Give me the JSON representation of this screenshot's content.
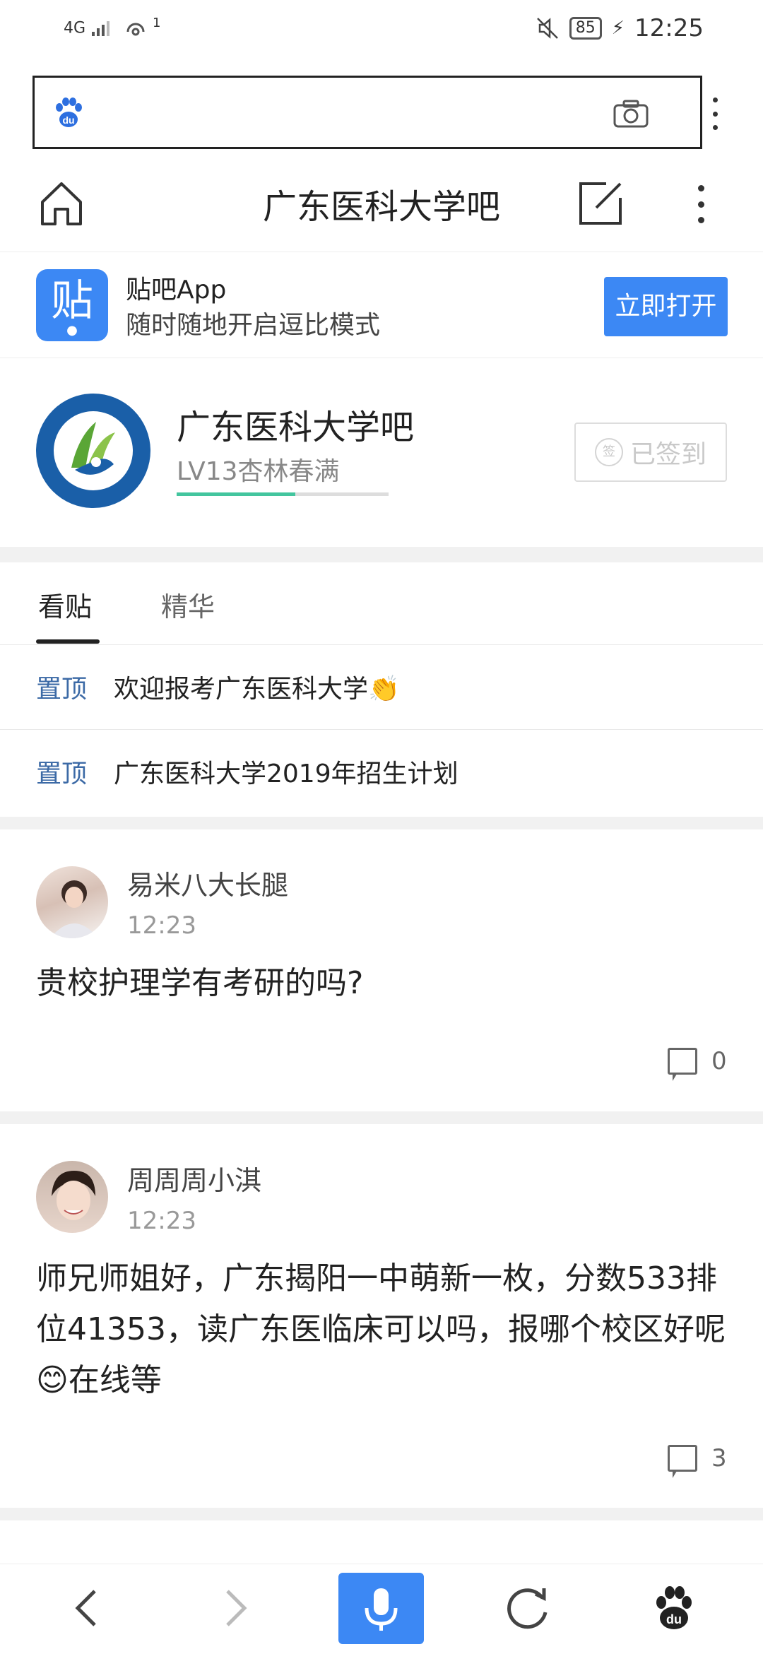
{
  "status_bar": {
    "network": "4G",
    "signal_superscript": "1",
    "battery": "85",
    "time": "12:25"
  },
  "icons": {
    "baidu_logo": "baidu-paw-icon",
    "camera": "camera-icon",
    "home": "home-icon",
    "edit": "edit-icon",
    "more": "more-vertical-icon",
    "back": "chevron-left-icon",
    "forward": "chevron-right-icon",
    "mic": "microphone-icon",
    "refresh": "refresh-icon"
  },
  "colors": {
    "accent": "#3c88f4",
    "pin_label": "#3c6aa6",
    "level_progress": "#43c59e"
  },
  "header": {
    "title": "广东医科大学吧"
  },
  "banner": {
    "app_icon_char": "贴",
    "title": "贴吧App",
    "subtitle": "随时随地开启逗比模式",
    "open_button": "立即打开"
  },
  "forum": {
    "name": "广东医科大学吧",
    "level": "LV13杏林春满",
    "level_progress": 0.56,
    "sign_icon_char": "签",
    "signed_label": "已签到"
  },
  "tabs": [
    {
      "label": "看贴",
      "active": true
    },
    {
      "label": "精华",
      "active": false
    }
  ],
  "pinned": [
    {
      "label": "置顶",
      "title": "欢迎报考广东医科大学👏"
    },
    {
      "label": "置顶",
      "title": "广东医科大学2019年招生计划"
    }
  ],
  "posts": [
    {
      "username": "易米八大长腿",
      "time": "12:23",
      "title": "贵校护理学有考研的吗?",
      "comments": "0"
    },
    {
      "username": "周周周小淇",
      "time": "12:23",
      "title": "师兄师姐好，广东揭阳一中萌新一枚，分数533排位41353，读广东医临床可以吗，报哪个校区好呢😊在线等",
      "comments": "3"
    }
  ]
}
